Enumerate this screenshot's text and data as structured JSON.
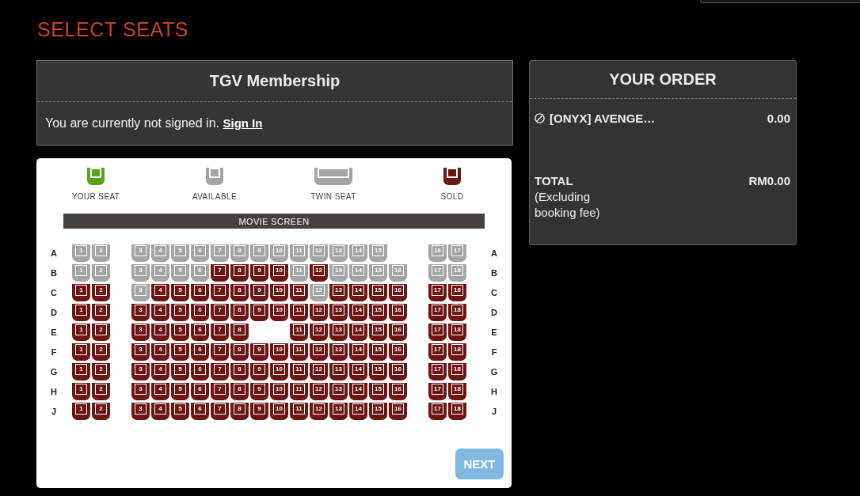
{
  "page_title": "SELECT SEATS",
  "membership": {
    "title": "TGV Membership",
    "message": "You are currently not signed in.",
    "link": "Sign In"
  },
  "seat_map": {
    "legend": [
      {
        "kind": "selected",
        "label": "YOUR SEAT"
      },
      {
        "kind": "available",
        "label": "AVAILABLE"
      },
      {
        "kind": "twin",
        "label": "TWIN SEAT"
      },
      {
        "kind": "sold",
        "label": "SOLD"
      }
    ],
    "screen_label": "MOVIE SCREEN",
    "rows": [
      {
        "label": "A",
        "label_end": "A",
        "sections": [
          [
            {
              "kind": "seat",
              "number": "1",
              "sold": false,
              "selected": false
            },
            {
              "kind": "seat",
              "number": "2",
              "sold": false,
              "selected": false
            }
          ],
          [
            {
              "kind": "seat",
              "number": "3",
              "sold": false,
              "selected": false
            },
            {
              "kind": "seat",
              "number": "4",
              "sold": false,
              "selected": false
            },
            {
              "kind": "seat",
              "number": "5",
              "sold": false,
              "selected": false
            },
            {
              "kind": "seat",
              "number": "6",
              "sold": false,
              "selected": false
            },
            {
              "kind": "seat",
              "number": "7",
              "sold": false,
              "selected": false
            },
            {
              "kind": "seat",
              "number": "8",
              "sold": false,
              "selected": false
            },
            {
              "kind": "seat",
              "number": "9",
              "sold": false,
              "selected": false
            },
            {
              "kind": "seat",
              "number": "10",
              "sold": false,
              "selected": false
            },
            {
              "kind": "seat",
              "number": "11",
              "sold": false,
              "selected": false
            },
            {
              "kind": "seat",
              "number": "12",
              "sold": false,
              "selected": false
            },
            {
              "kind": "seat",
              "number": "13",
              "sold": false,
              "selected": false
            },
            {
              "kind": "seat",
              "number": "14",
              "sold": false,
              "selected": false
            },
            {
              "kind": "seat",
              "number": "15",
              "sold": false,
              "selected": false
            }
          ],
          [
            {
              "kind": "seat",
              "number": "16",
              "sold": false,
              "selected": false
            },
            {
              "kind": "seat",
              "number": "17",
              "sold": false,
              "selected": false
            }
          ]
        ]
      },
      {
        "label": "B",
        "label_end": "B",
        "sections": [
          [
            {
              "kind": "seat",
              "number": "1",
              "sold": false,
              "selected": false
            },
            {
              "kind": "seat",
              "number": "2",
              "sold": false,
              "selected": false
            }
          ],
          [
            {
              "kind": "seat",
              "number": "3",
              "sold": false,
              "selected": false
            },
            {
              "kind": "seat",
              "number": "4",
              "sold": false,
              "selected": false
            },
            {
              "kind": "seat",
              "number": "5",
              "sold": false,
              "selected": false
            },
            {
              "kind": "seat",
              "number": "6",
              "sold": false,
              "selected": false
            },
            {
              "kind": "seat",
              "number": "7",
              "sold": true,
              "selected": false
            },
            {
              "kind": "seat",
              "number": "8",
              "sold": true,
              "selected": false
            },
            {
              "kind": "seat",
              "number": "9",
              "sold": true,
              "selected": false
            },
            {
              "kind": "seat",
              "number": "10",
              "sold": true,
              "selected": false
            },
            {
              "kind": "seat",
              "number": "11",
              "sold": false,
              "selected": false
            },
            {
              "kind": "seat",
              "number": "12",
              "sold": true,
              "selected": false
            },
            {
              "kind": "seat",
              "number": "13",
              "sold": false,
              "selected": false
            },
            {
              "kind": "seat",
              "number": "14",
              "sold": false,
              "selected": false
            },
            {
              "kind": "seat",
              "number": "15",
              "sold": false,
              "selected": false
            },
            {
              "kind": "seat",
              "number": "16",
              "sold": false,
              "selected": false
            }
          ],
          [
            {
              "kind": "seat",
              "number": "17",
              "sold": false,
              "selected": false
            },
            {
              "kind": "seat",
              "number": "18",
              "sold": false,
              "selected": false
            }
          ]
        ]
      },
      {
        "label": "C",
        "label_end": "C",
        "sections": [
          [
            {
              "kind": "seat",
              "number": "1",
              "sold": true,
              "selected": false
            },
            {
              "kind": "seat",
              "number": "2",
              "sold": true,
              "selected": false
            }
          ],
          [
            {
              "kind": "seat",
              "number": "3",
              "sold": false,
              "selected": false
            },
            {
              "kind": "seat",
              "number": "4",
              "sold": true,
              "selected": false
            },
            {
              "kind": "seat",
              "number": "5",
              "sold": true,
              "selected": false
            },
            {
              "kind": "seat",
              "number": "6",
              "sold": true,
              "selected": false
            },
            {
              "kind": "seat",
              "number": "7",
              "sold": true,
              "selected": false
            },
            {
              "kind": "seat",
              "number": "8",
              "sold": true,
              "selected": false
            },
            {
              "kind": "seat",
              "number": "9",
              "sold": true,
              "selected": false
            },
            {
              "kind": "seat",
              "number": "10",
              "sold": true,
              "selected": false
            },
            {
              "kind": "seat",
              "number": "11",
              "sold": true,
              "selected": false
            },
            {
              "kind": "seat",
              "number": "12",
              "sold": false,
              "selected": false
            },
            {
              "kind": "seat",
              "number": "13",
              "sold": true,
              "selected": false
            },
            {
              "kind": "seat",
              "number": "14",
              "sold": true,
              "selected": false
            },
            {
              "kind": "seat",
              "number": "15",
              "sold": true,
              "selected": false
            },
            {
              "kind": "seat",
              "number": "16",
              "sold": true,
              "selected": false
            }
          ],
          [
            {
              "kind": "seat",
              "number": "17",
              "sold": true,
              "selected": false
            },
            {
              "kind": "seat",
              "number": "18",
              "sold": true,
              "selected": false
            }
          ]
        ]
      },
      {
        "label": "D",
        "label_end": "D",
        "sections": [
          [
            {
              "kind": "seat",
              "number": "1",
              "sold": true,
              "selected": false
            },
            {
              "kind": "seat",
              "number": "2",
              "sold": true,
              "selected": false
            }
          ],
          [
            {
              "kind": "seat",
              "number": "3",
              "sold": true,
              "selected": false
            },
            {
              "kind": "seat",
              "number": "4",
              "sold": true,
              "selected": false
            },
            {
              "kind": "seat",
              "number": "5",
              "sold": true,
              "selected": false
            },
            {
              "kind": "seat",
              "number": "6",
              "sold": true,
              "selected": false
            },
            {
              "kind": "seat",
              "number": "7",
              "sold": true,
              "selected": false
            },
            {
              "kind": "seat",
              "number": "8",
              "sold": true,
              "selected": false
            },
            {
              "kind": "seat",
              "number": "9",
              "sold": true,
              "selected": false
            },
            {
              "kind": "seat",
              "number": "10",
              "sold": true,
              "selected": false
            },
            {
              "kind": "seat",
              "number": "11",
              "sold": true,
              "selected": false
            },
            {
              "kind": "seat",
              "number": "12",
              "sold": true,
              "selected": false
            },
            {
              "kind": "seat",
              "number": "13",
              "sold": true,
              "selected": false
            },
            {
              "kind": "seat",
              "number": "14",
              "sold": true,
              "selected": false
            },
            {
              "kind": "seat",
              "number": "15",
              "sold": true,
              "selected": false
            },
            {
              "kind": "seat",
              "number": "16",
              "sold": true,
              "selected": false
            }
          ],
          [
            {
              "kind": "seat",
              "number": "17",
              "sold": true,
              "selected": false
            },
            {
              "kind": "seat",
              "number": "18",
              "sold": true,
              "selected": false
            }
          ]
        ]
      },
      {
        "label": "E",
        "label_end": "E",
        "sections": [
          [
            {
              "kind": "seat",
              "number": "1",
              "sold": true,
              "selected": false
            },
            {
              "kind": "seat",
              "number": "2",
              "sold": true,
              "selected": false
            }
          ],
          [
            {
              "kind": "seat",
              "number": "3",
              "sold": true,
              "selected": false
            },
            {
              "kind": "seat",
              "number": "4",
              "sold": true,
              "selected": false
            },
            {
              "kind": "seat",
              "number": "5",
              "sold": true,
              "selected": false
            },
            {
              "kind": "seat",
              "number": "6",
              "sold": true,
              "selected": false
            },
            {
              "kind": "seat",
              "number": "7",
              "sold": true,
              "selected": false
            },
            {
              "kind": "seat",
              "number": "8",
              "sold": true,
              "selected": false
            },
            {
              "kind": "space"
            },
            {
              "kind": "space"
            },
            {
              "kind": "seat",
              "number": "11",
              "sold": true,
              "selected": false
            },
            {
              "kind": "seat",
              "number": "12",
              "sold": true,
              "selected": false
            },
            {
              "kind": "seat",
              "number": "13",
              "sold": true,
              "selected": false
            },
            {
              "kind": "seat",
              "number": "14",
              "sold": true,
              "selected": false
            },
            {
              "kind": "seat",
              "number": "15",
              "sold": true,
              "selected": false
            },
            {
              "kind": "seat",
              "number": "16",
              "sold": true,
              "selected": false
            }
          ],
          [
            {
              "kind": "seat",
              "number": "17",
              "sold": true,
              "selected": false
            },
            {
              "kind": "seat",
              "number": "18",
              "sold": true,
              "selected": false
            }
          ]
        ]
      },
      {
        "label": "F",
        "label_end": "F",
        "sections": [
          [
            {
              "kind": "seat",
              "number": "1",
              "sold": true,
              "selected": false
            },
            {
              "kind": "seat",
              "number": "2",
              "sold": true,
              "selected": false
            }
          ],
          [
            {
              "kind": "seat",
              "number": "3",
              "sold": true,
              "selected": false
            },
            {
              "kind": "seat",
              "number": "4",
              "sold": true,
              "selected": false
            },
            {
              "kind": "seat",
              "number": "5",
              "sold": true,
              "selected": false
            },
            {
              "kind": "seat",
              "number": "6",
              "sold": true,
              "selected": false
            },
            {
              "kind": "seat",
              "number": "7",
              "sold": true,
              "selected": false
            },
            {
              "kind": "seat",
              "number": "8",
              "sold": true,
              "selected": false
            },
            {
              "kind": "seat",
              "number": "9",
              "sold": true,
              "selected": false
            },
            {
              "kind": "seat",
              "number": "10",
              "sold": true,
              "selected": false
            },
            {
              "kind": "seat",
              "number": "11",
              "sold": true,
              "selected": false
            },
            {
              "kind": "seat",
              "number": "12",
              "sold": true,
              "selected": false
            },
            {
              "kind": "seat",
              "number": "13",
              "sold": true,
              "selected": false
            },
            {
              "kind": "seat",
              "number": "14",
              "sold": true,
              "selected": false
            },
            {
              "kind": "seat",
              "number": "15",
              "sold": true,
              "selected": false
            },
            {
              "kind": "seat",
              "number": "16",
              "sold": true,
              "selected": false
            }
          ],
          [
            {
              "kind": "seat",
              "number": "17",
              "sold": true,
              "selected": false
            },
            {
              "kind": "seat",
              "number": "18",
              "sold": true,
              "selected": false
            }
          ]
        ]
      },
      {
        "label": "G",
        "label_end": "G",
        "sections": [
          [
            {
              "kind": "seat",
              "number": "1",
              "sold": true,
              "selected": false
            },
            {
              "kind": "seat",
              "number": "2",
              "sold": true,
              "selected": false
            }
          ],
          [
            {
              "kind": "seat",
              "number": "3",
              "sold": true,
              "selected": false
            },
            {
              "kind": "seat",
              "number": "4",
              "sold": true,
              "selected": false
            },
            {
              "kind": "seat",
              "number": "5",
              "sold": true,
              "selected": false
            },
            {
              "kind": "seat",
              "number": "6",
              "sold": true,
              "selected": false
            },
            {
              "kind": "seat",
              "number": "7",
              "sold": true,
              "selected": false
            },
            {
              "kind": "seat",
              "number": "8",
              "sold": true,
              "selected": false
            },
            {
              "kind": "seat",
              "number": "9",
              "sold": true,
              "selected": false
            },
            {
              "kind": "seat",
              "number": "10",
              "sold": true,
              "selected": false
            },
            {
              "kind": "seat",
              "number": "11",
              "sold": true,
              "selected": false
            },
            {
              "kind": "seat",
              "number": "12",
              "sold": true,
              "selected": false
            },
            {
              "kind": "seat",
              "number": "13",
              "sold": true,
              "selected": false
            },
            {
              "kind": "seat",
              "number": "14",
              "sold": true,
              "selected": false
            },
            {
              "kind": "seat",
              "number": "15",
              "sold": true,
              "selected": false
            },
            {
              "kind": "seat",
              "number": "16",
              "sold": true,
              "selected": false
            }
          ],
          [
            {
              "kind": "seat",
              "number": "17",
              "sold": true,
              "selected": false
            },
            {
              "kind": "seat",
              "number": "18",
              "sold": true,
              "selected": false
            }
          ]
        ]
      },
      {
        "label": "H",
        "label_end": "H",
        "sections": [
          [
            {
              "kind": "seat",
              "number": "1",
              "sold": true,
              "selected": false
            },
            {
              "kind": "seat",
              "number": "2",
              "sold": true,
              "selected": false
            }
          ],
          [
            {
              "kind": "seat",
              "number": "3",
              "sold": true,
              "selected": false
            },
            {
              "kind": "seat",
              "number": "4",
              "sold": true,
              "selected": false
            },
            {
              "kind": "seat",
              "number": "5",
              "sold": true,
              "selected": false
            },
            {
              "kind": "seat",
              "number": "6",
              "sold": true,
              "selected": false
            },
            {
              "kind": "seat",
              "number": "7",
              "sold": true,
              "selected": false
            },
            {
              "kind": "seat",
              "number": "8",
              "sold": true,
              "selected": false
            },
            {
              "kind": "seat",
              "number": "9",
              "sold": true,
              "selected": false
            },
            {
              "kind": "seat",
              "number": "10",
              "sold": true,
              "selected": false
            },
            {
              "kind": "seat",
              "number": "11",
              "sold": true,
              "selected": false
            },
            {
              "kind": "seat",
              "number": "12",
              "sold": true,
              "selected": false
            },
            {
              "kind": "seat",
              "number": "13",
              "sold": true,
              "selected": false
            },
            {
              "kind": "seat",
              "number": "14",
              "sold": true,
              "selected": false
            },
            {
              "kind": "seat",
              "number": "15",
              "sold": true,
              "selected": false
            },
            {
              "kind": "seat",
              "number": "16",
              "sold": true,
              "selected": false
            }
          ],
          [
            {
              "kind": "seat",
              "number": "17",
              "sold": true,
              "selected": false
            },
            {
              "kind": "seat",
              "number": "18",
              "sold": true,
              "selected": false
            }
          ]
        ]
      },
      {
        "label": "J",
        "label_end": "J",
        "sections": [
          [
            {
              "kind": "seat",
              "number": "1",
              "sold": true,
              "selected": false
            },
            {
              "kind": "seat",
              "number": "2",
              "sold": true,
              "selected": false
            }
          ],
          [
            {
              "kind": "seat",
              "number": "3",
              "sold": true,
              "selected": false
            },
            {
              "kind": "seat",
              "number": "4",
              "sold": true,
              "selected": false
            },
            {
              "kind": "seat",
              "number": "5",
              "sold": true,
              "selected": false
            },
            {
              "kind": "seat",
              "number": "6",
              "sold": true,
              "selected": false
            },
            {
              "kind": "seat",
              "number": "7",
              "sold": true,
              "selected": false
            },
            {
              "kind": "seat",
              "number": "8",
              "sold": true,
              "selected": false
            },
            {
              "kind": "seat",
              "number": "9",
              "sold": true,
              "selected": false
            },
            {
              "kind": "seat",
              "number": "10",
              "sold": true,
              "selected": false
            },
            {
              "kind": "seat",
              "number": "11",
              "sold": true,
              "selected": false
            },
            {
              "kind": "seat",
              "number": "12",
              "sold": true,
              "selected": false
            },
            {
              "kind": "seat",
              "number": "13",
              "sold": true,
              "selected": false
            },
            {
              "kind": "seat",
              "number": "14",
              "sold": true,
              "selected": false
            },
            {
              "kind": "seat",
              "number": "15",
              "sold": true,
              "selected": false
            },
            {
              "kind": "seat",
              "number": "16",
              "sold": true,
              "selected": false
            }
          ],
          [
            {
              "kind": "seat",
              "number": "17",
              "sold": true,
              "selected": false
            },
            {
              "kind": "seat",
              "number": "18",
              "sold": true,
              "selected": false
            }
          ]
        ]
      }
    ],
    "next_button": {
      "label": "NEXT",
      "disabled": true
    }
  },
  "order": {
    "title": "YOUR ORDER",
    "items": [
      {
        "name": "[ONYX] AVENGE…",
        "price": "0.00"
      }
    ],
    "total_label": "TOTAL",
    "total_note": "(Excluding booking fee)",
    "total": "RM0.00"
  }
}
